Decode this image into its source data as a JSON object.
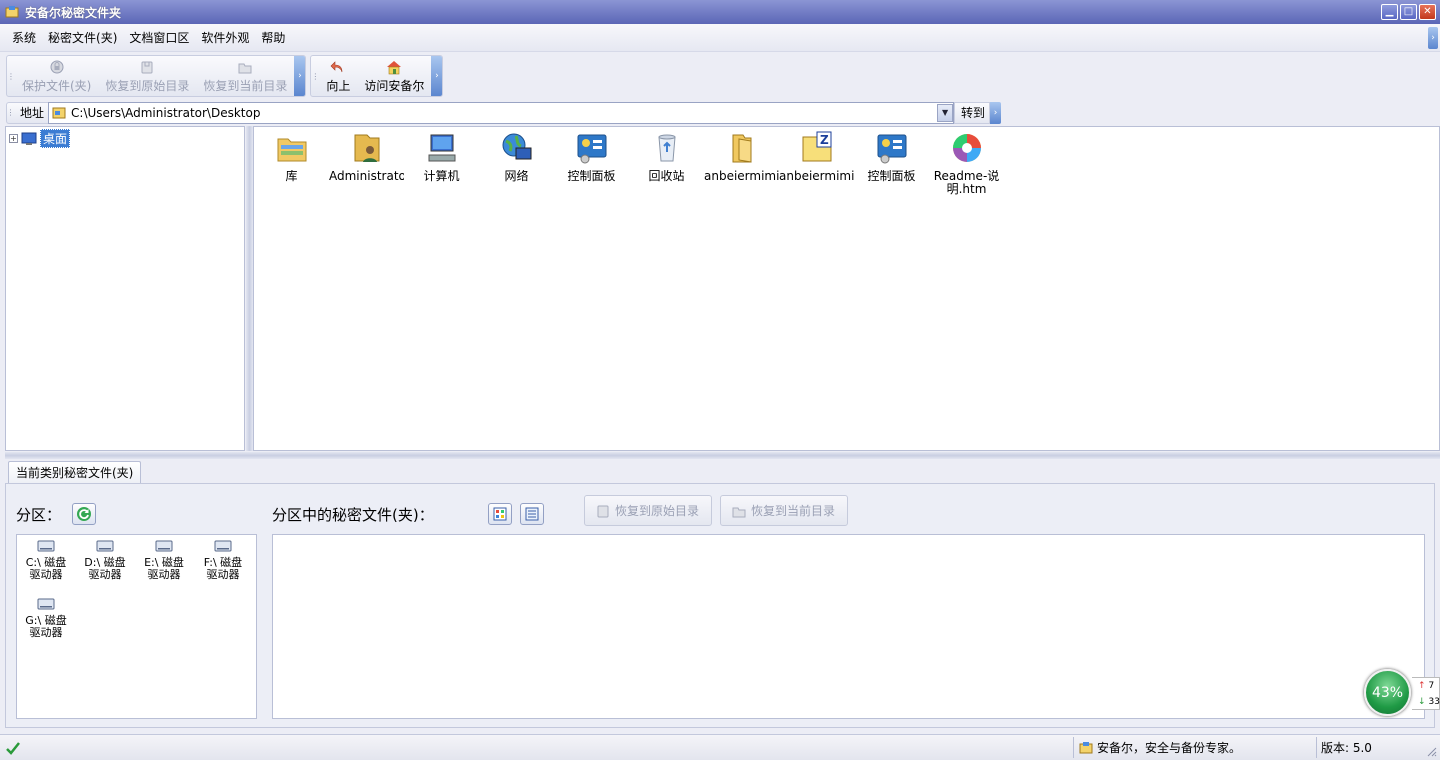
{
  "window": {
    "title": "安备尔秘密文件夹"
  },
  "menu": [
    "系统",
    "秘密文件(夹)",
    "文档窗口区",
    "软件外观",
    "帮助"
  ],
  "toolbar": {
    "protect": "保护文件(夹)",
    "restore_original": "恢复到原始目录",
    "restore_current": "恢复到当前目录",
    "up": "向上",
    "visit": "访问安备尔"
  },
  "address": {
    "label": "地址",
    "value": "C:\\Users\\Administrator\\Desktop",
    "go": "转到"
  },
  "tree": {
    "root_label": "桌面"
  },
  "files": [
    {
      "label": "库",
      "icon": "library-folder-icon"
    },
    {
      "label": "Administrator",
      "icon": "user-folder-icon"
    },
    {
      "label": "计算机",
      "icon": "computer-icon"
    },
    {
      "label": "网络",
      "icon": "network-icon"
    },
    {
      "label": "控制面板",
      "icon": "control-panel-icon"
    },
    {
      "label": "回收站",
      "icon": "recycle-bin-icon"
    },
    {
      "label": "anbeiermimi...",
      "icon": "folder-icon"
    },
    {
      "label": "anbeiermimi...",
      "icon": "zip-archive-icon"
    },
    {
      "label": "控制面板",
      "icon": "control-panel-icon"
    },
    {
      "label": "Readme-说明.htm",
      "icon": "browser-doc-icon"
    }
  ],
  "bottom": {
    "tab_label": "当前类别秘密文件(夹)",
    "partition_label": "分区：",
    "secret_label": "分区中的秘密文件(夹)：",
    "restore_original": "恢复到原始目录",
    "restore_current": "恢复到当前目录",
    "drives": [
      {
        "line1": "C:\\  磁盘",
        "line2": "驱动器"
      },
      {
        "line1": "D:\\  磁盘",
        "line2": "驱动器"
      },
      {
        "line1": "E:\\  磁盘",
        "line2": "驱动器"
      },
      {
        "line1": "F:\\  磁盘",
        "line2": "驱动器"
      },
      {
        "line1": "G:\\  磁盘",
        "line2": "驱动器"
      }
    ]
  },
  "status": {
    "message": "安备尔，安全与备份专家。",
    "version": "版本: 5.0"
  },
  "net_widget": {
    "percent": "43%",
    "up": "7",
    "down": "33"
  }
}
